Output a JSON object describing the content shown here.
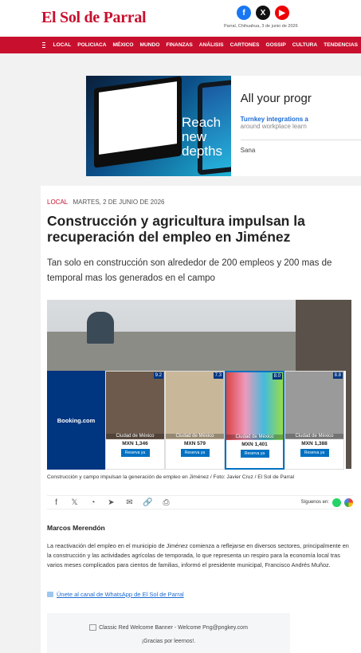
{
  "header": {
    "logo": "El Sol de Parral",
    "dateline": "Parral, Chihuahua, 3 de junio de 2026",
    "social": [
      {
        "icon": "facebook-icon",
        "glyph": "f"
      },
      {
        "icon": "x-icon",
        "glyph": "X"
      },
      {
        "icon": "youtube-icon",
        "glyph": "▶"
      }
    ]
  },
  "nav": {
    "items": [
      "LOCAL",
      "POLICIACA",
      "MÉXICO",
      "MUNDO",
      "FINANZAS",
      "ANÁLISIS",
      "CARTONES",
      "GOSSIP",
      "CULTURA",
      "TENDENCIAS"
    ]
  },
  "ad": {
    "headline": "Reach new depths",
    "title": "All your progr",
    "sub": "Turnkey integrations a",
    "sub2": "around workplace learn",
    "brand": "Sana"
  },
  "article": {
    "section": "LOCAL",
    "date": "MARTES, 2 DE JUNIO DE 2026",
    "title": "Construcción y agricultura impulsan la recuperación del empleo en Jiménez",
    "subtitle": "Tan solo en construcción son alrededor de 200 empleos y 200 mas de temporal mas los generados en el campo",
    "caption": "Construcción y campo impulsan la generación de empleo en Jiménez / Foto: Javier Cruz / El Sol de Parral",
    "follow": "Síguenos en:",
    "author": "Marcos Merendón",
    "body": "La reactivación del empleo en el municipio de Jiménez comienza a reflejarse en diversos sectores, principalmente en la construcción y las actividades agrícolas de temporada, lo que representa un respiro para la economía local tras varios meses complicados para cientos de familias, informó el presidente municipal, Francisco Andrés Muñoz.",
    "whatsapp_link": "Únete al canal de WhatsApp de El Sol de Parral",
    "banner_alt": "Classic Red Welcome Banner - Welcome Png@pngkey.com",
    "banner_thanks": "¡Gracias por leernos!."
  },
  "booking": {
    "brand": "Booking.com",
    "hotels": [
      {
        "score": "9.2",
        "city": "Ciudad de México",
        "price": "MXN 1,346",
        "button": "Reserva ya"
      },
      {
        "score": "7.3",
        "city": "Ciudad de México",
        "price": "MXN 579",
        "button": "Reserva ya"
      },
      {
        "score": "8.0",
        "city": "Ciudad de México",
        "price": "MXN 1,401",
        "button": "Reserva ya"
      },
      {
        "score": "8.8",
        "city": "Ciudad de México",
        "price": "MXN 1,388",
        "button": "Reserva ya"
      }
    ]
  },
  "share_icons": [
    "facebook-icon",
    "x-icon",
    "whatsapp-icon",
    "telegram-icon",
    "mail-icon",
    "link-icon",
    "print-icon"
  ]
}
